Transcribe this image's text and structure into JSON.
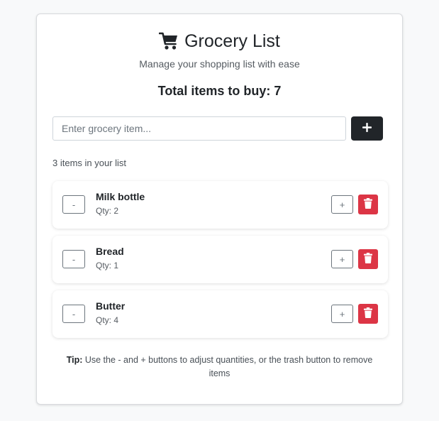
{
  "header": {
    "icon": "cart-icon",
    "title": "Grocery List",
    "subtitle": "Manage your shopping list with ease",
    "total_label": "Total items to buy: 7"
  },
  "input": {
    "placeholder": "Enter grocery item...",
    "value": "",
    "add_label": "+"
  },
  "list": {
    "count_text": "3 items in your list",
    "items": [
      {
        "name": "Milk bottle",
        "qty": "Qty: 2"
      },
      {
        "name": "Bread",
        "qty": "Qty: 1"
      },
      {
        "name": "Butter",
        "qty": "Qty: 4"
      }
    ],
    "decrement_label": "-",
    "increment_label": "+"
  },
  "tip": {
    "label": "Tip:",
    "text": " Use the - and + buttons to adjust quantities, or the trash button to remove items"
  },
  "colors": {
    "primary": "#212529",
    "danger": "#dc3545",
    "outline": "#6c757d"
  }
}
